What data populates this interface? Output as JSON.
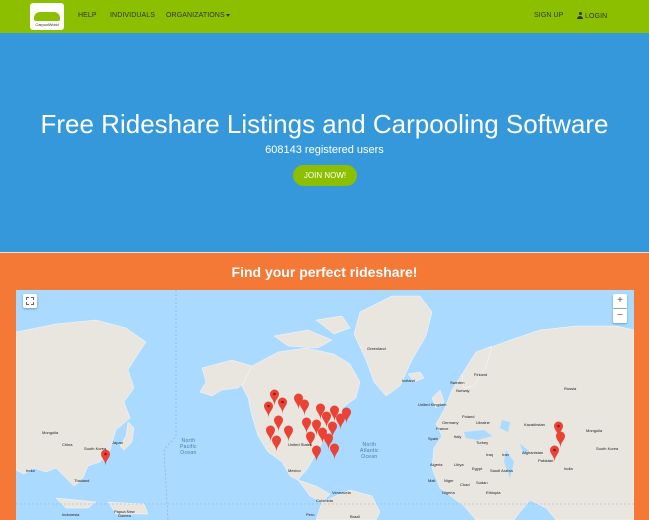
{
  "navbar": {
    "logo_text": "CarpoolWorld",
    "help": "HELP",
    "individuals": "INDIVIDUALS",
    "organizations": "ORGANIZATIONS",
    "sign_up": "SIGN UP",
    "login": "LOGIN"
  },
  "hero": {
    "title": "Free Rideshare Listings and Carpooling Software",
    "subtitle": "608143 registered users",
    "join_button": "JOIN NOW!"
  },
  "find": {
    "title": "Find your perfect rideshare!"
  },
  "map": {
    "controls": {
      "zoom_in": "+",
      "zoom_out": "−"
    },
    "ocean_labels": {
      "north_pacific": [
        "North",
        "Pacific",
        "Ocean"
      ],
      "north_atlantic": [
        "North",
        "Atlantic",
        "Ocean"
      ]
    },
    "place_labels": {
      "greenland": "Greenland",
      "iceland": "Iceland",
      "sweden": "Sweden",
      "finland": "Finland",
      "russia": "Russia",
      "norway": "Norway",
      "united_kingdom": "United Kingdom",
      "germany": "Germany",
      "poland": "Poland",
      "ukraine": "Ukraine",
      "france": "France",
      "spain": "Spain",
      "italy": "Italy",
      "turkey": "Turkey",
      "kazakhstan": "Kazakhstan",
      "mongolia": "Mongolia",
      "china": "China",
      "south_korea": "South Korea",
      "japan": "Japan",
      "afghanistan": "Afghanistan",
      "pakistan": "Pakistan",
      "india": "India",
      "iran": "Iran",
      "iraq": "Iraq",
      "saudi_arabia": "Saudi Arabia",
      "egypt": "Egypt",
      "libya": "Libya",
      "algeria": "Algeria",
      "mali": "Mali",
      "niger": "Niger",
      "chad": "Chad",
      "sudan": "Sudan",
      "ethiopia": "Ethiopia",
      "nigeria": "Nigeria",
      "thailand": "Thailand",
      "indonesia": "Indonesia",
      "papua_new_guinea": [
        "Papua New",
        "Guinea"
      ],
      "mexico": "Mexico",
      "venezuela": "Venezuela",
      "colombia": "Colombia",
      "brazil": "Brazil",
      "peru": "Peru",
      "united_states": "United States"
    },
    "marker_color": "#ea4335",
    "land_color": "#e8e6df",
    "water_color": "#aadaff"
  },
  "colors": {
    "navbar": "#8cbf00",
    "hero": "#3498db",
    "find": "#f47836",
    "button": "#8cbf00"
  }
}
